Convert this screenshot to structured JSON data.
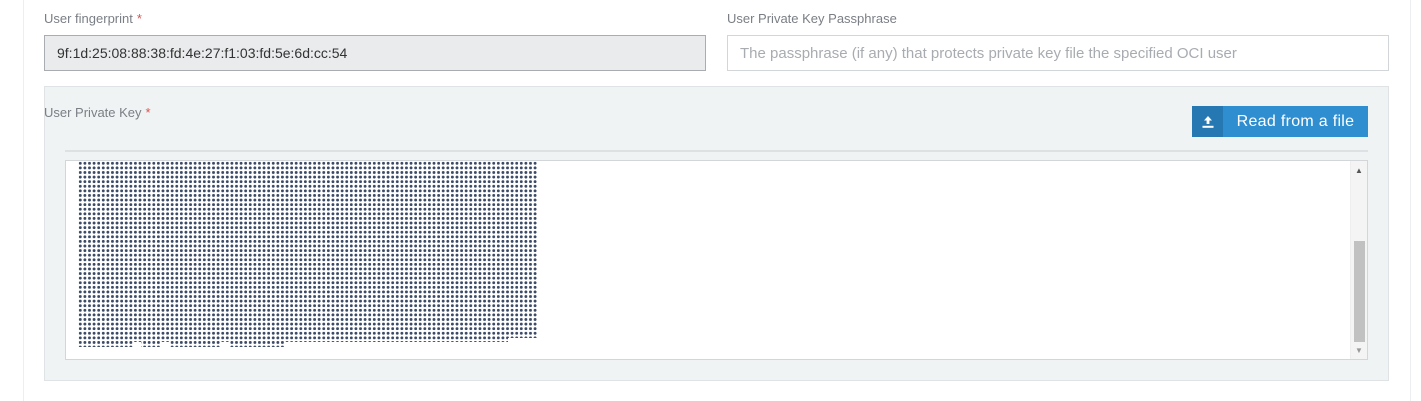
{
  "fingerprint": {
    "label": "User fingerprint",
    "required_mark": "*",
    "value": "9f:1d:25:08:88:38:fd:4e:27:f1:03:fd:5e:6d:cc:54"
  },
  "passphrase": {
    "label": "User Private Key Passphrase",
    "placeholder": "The passphrase (if any) that protects private key file the specified OCI user"
  },
  "private_key": {
    "label": "User Private Key",
    "required_mark": "*",
    "read_button_label": "Read from a file",
    "read_button_icon": "upload-icon",
    "content_masked": true
  },
  "colors": {
    "accent": "#2f8ecf",
    "accent_dark": "#2678b3",
    "required": "#d9534f",
    "mask_dots": "#3b4a66"
  }
}
